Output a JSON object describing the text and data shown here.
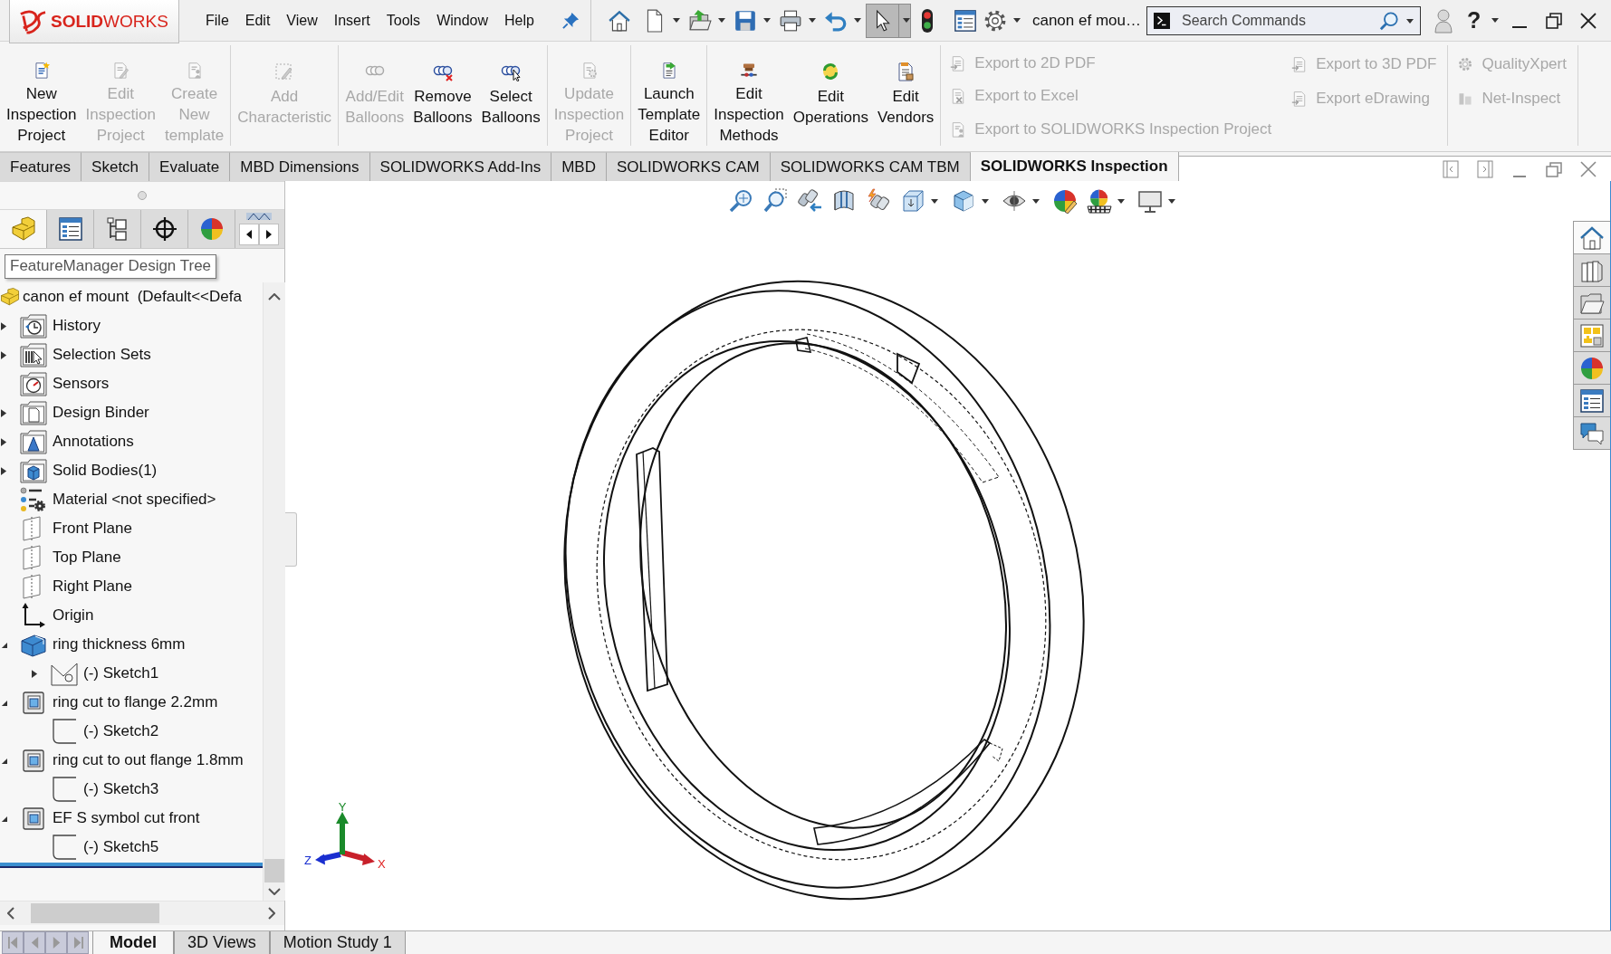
{
  "title_bar": {
    "logo": "**SOLID**WORKS",
    "menu": [
      "File",
      "Edit",
      "View",
      "Insert",
      "Tools",
      "Window",
      "Help"
    ],
    "select_tool": {
      "pressed": true
    },
    "document_title": "canon ef mou…",
    "search": {
      "placeholder": "Search Commands"
    },
    "help": "?"
  },
  "ribbon": {
    "groups": [
      {
        "kind": "large",
        "buttons": [
          {
            "kind": "new",
            "lines": [
              "New",
              "Inspection",
              "Project"
            ],
            "disabled": false
          },
          {
            "kind": "edit",
            "lines": [
              "Edit",
              "Inspection",
              "Project"
            ],
            "disabled": true
          },
          {
            "kind": "template",
            "lines": [
              "Create",
              "New",
              "template"
            ],
            "disabled": true
          }
        ]
      },
      {
        "kind": "large",
        "buttons": [
          {
            "kind": "characteristic",
            "lines": [
              "Add",
              "Characteristic"
            ],
            "disabled": true
          }
        ]
      },
      {
        "kind": "large",
        "buttons": [
          {
            "kind": "balloons",
            "lines": [
              "Add/Edit",
              "Balloons"
            ],
            "disabled": true
          },
          {
            "kind": "remove",
            "lines": [
              "Remove",
              "Balloons"
            ],
            "disabled": false
          },
          {
            "kind": "select",
            "lines": [
              "Select",
              "Balloons"
            ],
            "disabled": false
          }
        ]
      },
      {
        "kind": "large",
        "buttons": [
          {
            "kind": "update",
            "lines": [
              "Update",
              "Inspection",
              "Project"
            ],
            "disabled": true
          }
        ]
      },
      {
        "kind": "large",
        "buttons": [
          {
            "kind": "launch",
            "lines": [
              "Launch",
              "Template",
              "Editor"
            ],
            "disabled": false
          }
        ]
      },
      {
        "kind": "large",
        "buttons": [
          {
            "kind": "methods",
            "lines": [
              "Edit",
              "Inspection",
              "Methods"
            ],
            "disabled": false
          },
          {
            "kind": "operations",
            "lines": [
              "Edit",
              "Operations"
            ],
            "disabled": false
          },
          {
            "kind": "vendors",
            "lines": [
              "Edit",
              "Vendors"
            ],
            "disabled": false
          }
        ]
      },
      {
        "kind": "small",
        "columns": [
          [
            {
              "kind": "export",
              "label": "Export to 2D PDF",
              "disabled": true
            },
            {
              "kind": "excel",
              "label": "Export to Excel",
              "disabled": true
            },
            {
              "kind": "project",
              "label": "Export to SOLIDWORKS Inspection Project",
              "disabled": true
            }
          ],
          [
            {
              "kind": "export",
              "label": "Export to 3D PDF",
              "disabled": true
            },
            {
              "kind": "export",
              "label": "Export eDrawing",
              "disabled": true
            }
          ]
        ]
      },
      {
        "kind": "small",
        "columns": [
          [
            {
              "kind": "gear",
              "label": "QualityXpert",
              "disabled": true
            },
            {
              "kind": "bars",
              "label": "Net-Inspect",
              "disabled": true
            }
          ]
        ]
      }
    ]
  },
  "command_tabs": [
    {
      "label": "Features",
      "selected": false
    },
    {
      "label": "Sketch",
      "selected": false
    },
    {
      "label": "Evaluate",
      "selected": false
    },
    {
      "label": "MBD Dimensions",
      "selected": false
    },
    {
      "label": "SOLIDWORKS Add-Ins",
      "selected": false
    },
    {
      "label": "MBD",
      "selected": false
    },
    {
      "label": "SOLIDWORKS CAM",
      "selected": false
    },
    {
      "label": "SOLIDWORKS CAM TBM",
      "selected": false
    },
    {
      "label": "SOLIDWORKS Inspection",
      "selected": true
    }
  ],
  "panel": {
    "tabs": [
      {
        "kind": "features",
        "selected": true
      },
      {
        "kind": "properties",
        "selected": false
      },
      {
        "kind": "configurations",
        "selected": false
      },
      {
        "kind": "dimxpert",
        "selected": false
      },
      {
        "kind": "display",
        "selected": false
      }
    ],
    "tooltip": "FeatureManager Design Tree",
    "tree": {
      "root": {
        "kind": "part",
        "label": "canon ef mount  (Default<<Defa"
      },
      "items": [
        {
          "kind": "history",
          "label": "History",
          "expanded": false
        },
        {
          "kind": "selection",
          "label": "Selection Sets",
          "expanded": false
        },
        {
          "kind": "sensors",
          "label": "Sensors"
        },
        {
          "kind": "binder",
          "label": "Design Binder",
          "expanded": false
        },
        {
          "kind": "annotations",
          "label": "Annotations",
          "expanded": false
        },
        {
          "kind": "bodies",
          "label": "Solid Bodies(1)",
          "expanded": false
        },
        {
          "kind": "material",
          "label": "Material <not specified>"
        },
        {
          "kind": "plane",
          "label": "Front Plane"
        },
        {
          "kind": "plane",
          "label": "Top Plane"
        },
        {
          "kind": "plane",
          "label": "Right Plane"
        },
        {
          "kind": "origin",
          "label": "Origin"
        },
        {
          "kind": "boss",
          "label": "ring thickness 6mm",
          "expanded": true,
          "children": [
            {
              "kind": "profile",
              "label": "(-) Sketch1",
              "expanded": false
            }
          ]
        },
        {
          "kind": "cut",
          "label": "ring cut to flange 2.2mm",
          "expanded": true,
          "children": [
            {
              "kind": "sketch",
              "label": "(-) Sketch2"
            }
          ]
        },
        {
          "kind": "cut",
          "label": "ring cut to out flange 1.8mm",
          "expanded": true,
          "children": [
            {
              "kind": "sketch",
              "label": "(-) Sketch3"
            }
          ]
        },
        {
          "kind": "cut",
          "label": "EF S symbol cut front",
          "expanded": true,
          "children": [
            {
              "kind": "sketch",
              "label": "(-) Sketch5"
            }
          ]
        }
      ]
    }
  },
  "viewport": {
    "triad": {
      "x": "X",
      "y": "Y",
      "z": "Z"
    },
    "task_pane": [
      {
        "kind": "home",
        "selected": true
      },
      {
        "kind": "library",
        "selected": false
      },
      {
        "kind": "explorer",
        "selected": false
      },
      {
        "kind": "palette",
        "selected": false
      },
      {
        "kind": "appearances",
        "selected": false
      },
      {
        "kind": "properties",
        "selected": false
      },
      {
        "kind": "forum",
        "selected": false
      }
    ]
  },
  "bottom_tabs": [
    {
      "label": "Model",
      "selected": true
    },
    {
      "label": "3D Views",
      "selected": false
    },
    {
      "label": "Motion Study 1",
      "selected": false
    }
  ]
}
